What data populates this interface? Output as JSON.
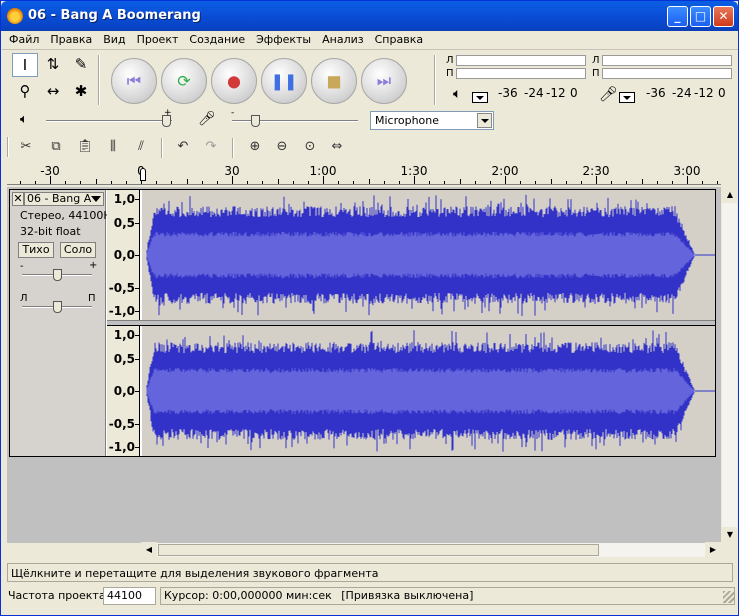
{
  "window": {
    "title": "06 - Bang A Boomerang"
  },
  "menu": [
    "Файл",
    "Правка",
    "Вид",
    "Проект",
    "Создание",
    "Эффекты",
    "Анализ",
    "Справка"
  ],
  "tools": [
    {
      "name": "selection-tool-icon",
      "glyph": "I"
    },
    {
      "name": "envelope-tool-icon",
      "glyph": "⇅"
    },
    {
      "name": "draw-tool-icon",
      "glyph": "✎"
    },
    {
      "name": "zoom-tool-icon",
      "glyph": "⚲"
    },
    {
      "name": "timeshift-tool-icon",
      "glyph": "↔"
    },
    {
      "name": "multi-tool-icon",
      "glyph": "✱"
    }
  ],
  "transport": [
    {
      "name": "skip-start-button",
      "glyph": "⏮",
      "color": "#8f7bd9"
    },
    {
      "name": "loop-play-button",
      "glyph": "⟳",
      "color": "#2fae45"
    },
    {
      "name": "record-button",
      "glyph": "●",
      "color": "#d23a3a"
    },
    {
      "name": "pause-button",
      "glyph": "❚❚",
      "color": "#3f6fe0"
    },
    {
      "name": "stop-button",
      "glyph": "■",
      "color": "#c8a85a"
    },
    {
      "name": "skip-end-button",
      "glyph": "⏭",
      "color": "#8f7bd9"
    }
  ],
  "meters": {
    "left_letter": "Л",
    "right_letter": "П",
    "play_scale": [
      "-36",
      "-24",
      "-12",
      "0"
    ],
    "rec_scale": [
      "-36",
      "-24",
      "-12",
      "0"
    ]
  },
  "mixer": {
    "input_source": "Microphone"
  },
  "ruler": {
    "labels": [
      "-30",
      "0",
      "30",
      "1:00",
      "1:30",
      "2:00",
      "2:30",
      "3:00"
    ],
    "label_seconds": [
      -30,
      0,
      30,
      60,
      90,
      120,
      150,
      180
    ]
  },
  "track": {
    "name": "06 - Bang A",
    "format": "Стерео, 44100Hz",
    "bitdepth": "32-bit float",
    "mute": "Тихо",
    "solo": "Соло",
    "gain_minus": "-",
    "gain_plus": "+",
    "pan_left": "Л",
    "pan_right": "П",
    "scale_labels": [
      "1,0",
      "0,5",
      "0,0",
      "-0,5",
      "-1,0"
    ],
    "duration_seconds": 205,
    "gain_level": 0.5,
    "pan_level": 0.5
  },
  "status": {
    "hint": "Щёлкните и перетащите для выделения звукового фрагмента",
    "rate_label": "Частота проекта:",
    "rate_value": "44100",
    "cursor": "Курсор: 0:00,000000 мин:сек",
    "snap": "[Привязка выключена]"
  },
  "colors": {
    "wave_outer": "#3232c8",
    "wave_inner": "#6464dc",
    "wave_bg": "#d4d0c8"
  }
}
